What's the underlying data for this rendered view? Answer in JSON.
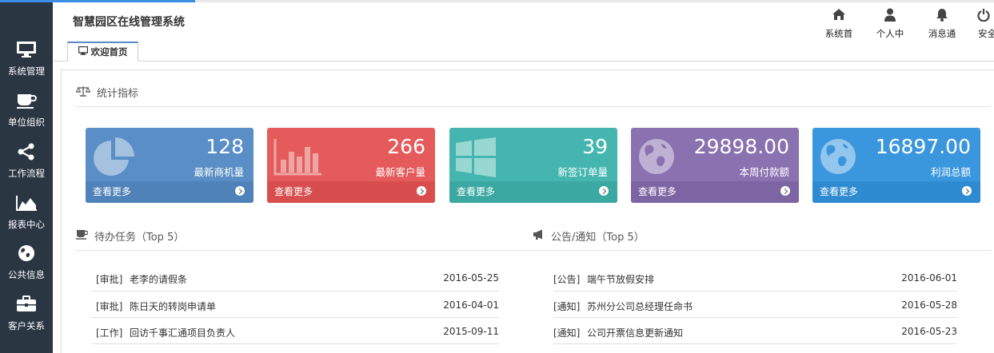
{
  "app": {
    "title": "智慧园区在线管理系统"
  },
  "sidebar": {
    "items": [
      {
        "label": "系统管理",
        "icon": "monitor-icon"
      },
      {
        "label": "单位组织",
        "icon": "coffee-icon"
      },
      {
        "label": "工作流程",
        "icon": "share-icon"
      },
      {
        "label": "报表中心",
        "icon": "area-chart-icon"
      },
      {
        "label": "公共信息",
        "icon": "globe-icon"
      },
      {
        "label": "客户关系",
        "icon": "briefcase-icon"
      }
    ]
  },
  "topnav": {
    "items": [
      {
        "label": "系统首",
        "icon": "home-icon"
      },
      {
        "label": "个人中",
        "icon": "user-icon"
      },
      {
        "label": "消息通",
        "icon": "bell-icon"
      },
      {
        "label": "安全",
        "icon": "power-icon"
      }
    ]
  },
  "tabs": [
    {
      "label": "欢迎首页",
      "icon": "monitor-icon"
    }
  ],
  "stats": {
    "title": "统计指标",
    "cards": [
      {
        "value": "128",
        "label": "最新商机量",
        "more": "查看更多",
        "color": "#5a8ec6",
        "foot": "#4f82b9",
        "icon": "pie-chart-icon"
      },
      {
        "value": "266",
        "label": "最新客户量",
        "more": "查看更多",
        "color": "#e55b5b",
        "foot": "#d84e4e",
        "icon": "bar-chart-icon"
      },
      {
        "value": "39",
        "label": "新签订单量",
        "more": "查看更多",
        "color": "#45b6af",
        "foot": "#3ba8a1",
        "icon": "windows-icon"
      },
      {
        "value": "29898.00",
        "label": "本周付款额",
        "more": "查看更多",
        "color": "#8a72b0",
        "foot": "#7d65a3",
        "icon": "globe-icon"
      },
      {
        "value": "16897.00",
        "label": "利润总额",
        "more": "查看更多",
        "color": "#3a97de",
        "foot": "#2f8bd1",
        "icon": "globe-icon"
      }
    ]
  },
  "todo": {
    "title": "待办任务（Top 5）",
    "rows": [
      {
        "tag": "[审批]",
        "text": "老李的请假条",
        "date": "2016-05-25"
      },
      {
        "tag": "[审批]",
        "text": "陈日天的转岗申请单",
        "date": "2016-04-01"
      },
      {
        "tag": "[工作]",
        "text": "回访千事汇通项目负责人",
        "date": "2015-09-11"
      }
    ]
  },
  "notice": {
    "title": "公告/通知（Top 5）",
    "rows": [
      {
        "tag": "[公告]",
        "text": "端午节放假安排",
        "date": "2016-06-01"
      },
      {
        "tag": "[通知]",
        "text": "苏州分公司总经理任命书",
        "date": "2016-05-28"
      },
      {
        "tag": "[通知]",
        "text": "公司开票信息更新通知",
        "date": "2016-05-23"
      }
    ]
  }
}
